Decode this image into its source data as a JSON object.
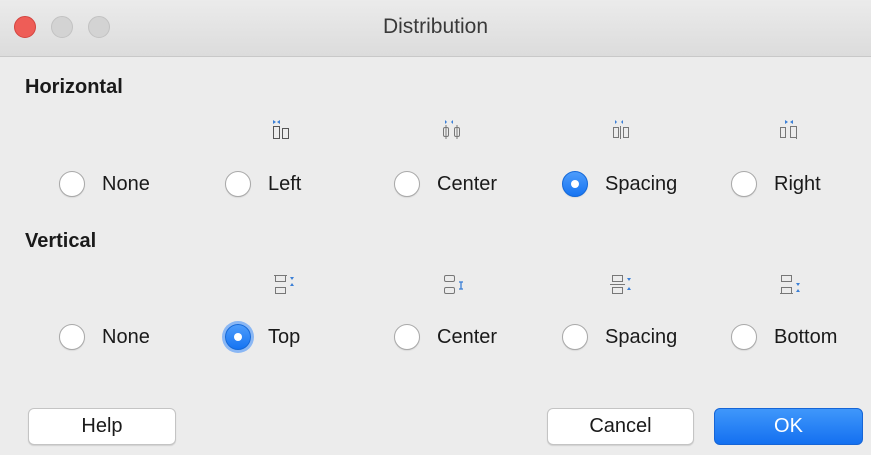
{
  "window": {
    "title": "Distribution",
    "accent_color": "#1674f2",
    "close_color": "#ee5d57"
  },
  "horizontal": {
    "label": "Horizontal",
    "options": [
      {
        "label": "None",
        "icon": "",
        "selected": false
      },
      {
        "label": "Left",
        "icon": "distribute-horizontal-left-icon",
        "selected": false
      },
      {
        "label": "Center",
        "icon": "distribute-horizontal-center-icon",
        "selected": false
      },
      {
        "label": "Spacing",
        "icon": "distribute-horizontal-spacing-icon",
        "selected": true
      },
      {
        "label": "Right",
        "icon": "distribute-horizontal-right-icon",
        "selected": false
      }
    ]
  },
  "vertical": {
    "label": "Vertical",
    "options": [
      {
        "label": "None",
        "icon": "",
        "selected": false
      },
      {
        "label": "Top",
        "icon": "distribute-vertical-top-icon",
        "selected": true
      },
      {
        "label": "Center",
        "icon": "distribute-vertical-center-icon",
        "selected": false
      },
      {
        "label": "Spacing",
        "icon": "distribute-vertical-spacing-icon",
        "selected": false
      },
      {
        "label": "Bottom",
        "icon": "distribute-vertical-bottom-icon",
        "selected": false
      }
    ]
  },
  "buttons": {
    "help": "Help",
    "cancel": "Cancel",
    "ok": "OK"
  }
}
